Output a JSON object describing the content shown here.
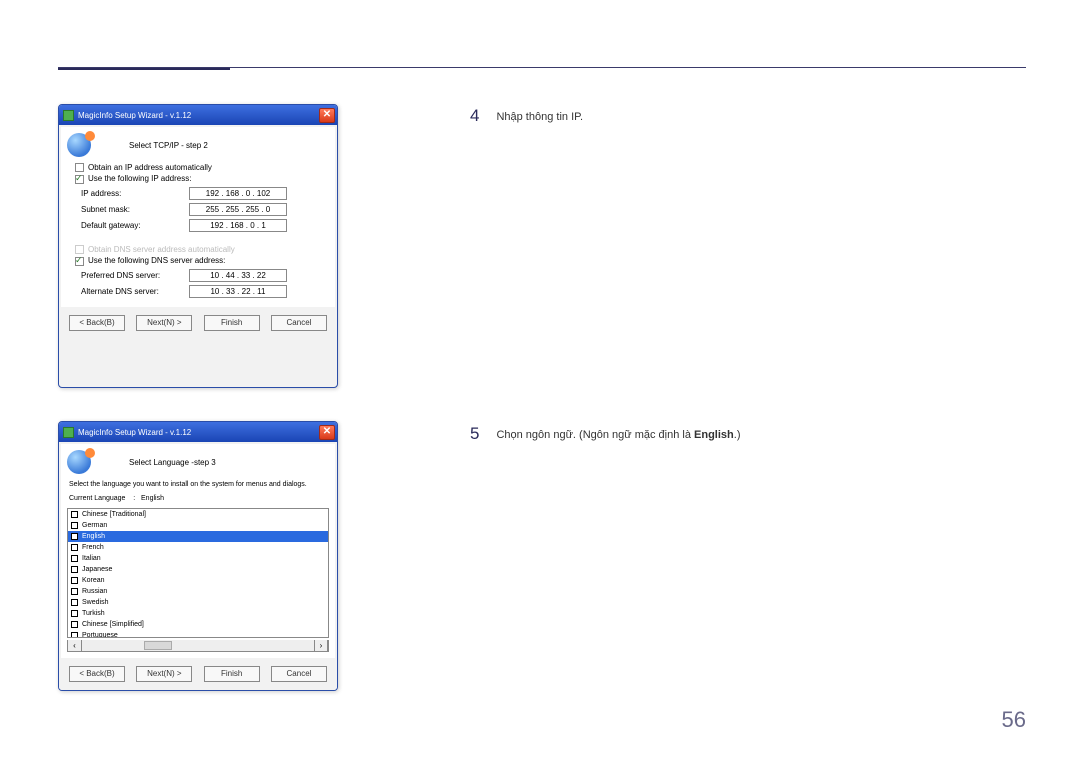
{
  "page_number": "56",
  "step4": {
    "num": "4",
    "text": "Nhập thông tin IP."
  },
  "step5": {
    "num": "5",
    "text_before": "Chọn ngôn ngữ. (Ngôn ngữ mặc định là ",
    "bold": "English",
    "text_after": ".)"
  },
  "dialog1": {
    "title": "MagicInfo Setup Wizard - v.1.12",
    "step_title": "Select TCP/IP - step 2",
    "obtain_ip": "Obtain an IP address automatically",
    "use_ip": "Use the following IP address:",
    "fields_ip": {
      "ip_label": "IP address:",
      "ip_val": "192 . 168 .   0  . 102",
      "sm_label": "Subnet mask:",
      "sm_val": "255 . 255 . 255 .   0",
      "gw_label": "Default gateway:",
      "gw_val": "192 . 168 .   0  .    1"
    },
    "obtain_dns": "Obtain DNS server address automatically",
    "use_dns": "Use the following DNS server address:",
    "fields_dns": {
      "p_label": "Preferred DNS server:",
      "p_val": "10 .  44 .  33 .  22",
      "a_label": "Alternate DNS server:",
      "a_val": "10 .  33 .  22 .  11"
    }
  },
  "dialog2": {
    "title": "MagicInfo Setup Wizard - v.1.12",
    "step_title": "Select Language -step 3",
    "para": "Select the language you want to install on the system for menus and dialogs.",
    "current_label": "Current Language",
    "current_sep": ":",
    "current_value": "English",
    "languages": [
      "Chinese [Traditional]",
      "German",
      "English",
      "French",
      "Italian",
      "Japanese",
      "Korean",
      "Russian",
      "Swedish",
      "Turkish",
      "Chinese [Simplified]",
      "Portuguese"
    ],
    "selected_index": 2
  },
  "buttons": {
    "back": "< Back(B)",
    "next": "Next(N) >",
    "finish": "Finish",
    "cancel": "Cancel"
  }
}
